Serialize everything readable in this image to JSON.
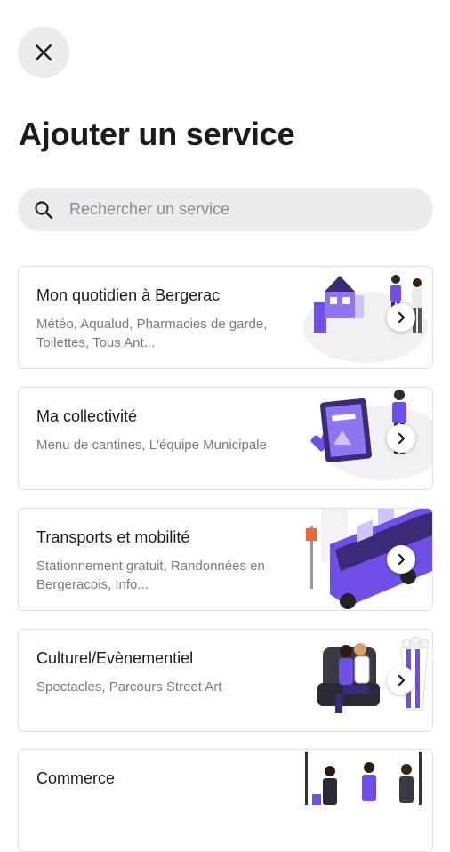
{
  "header": {
    "close_icon": "close-icon",
    "title": "Ajouter un service"
  },
  "search": {
    "placeholder": "Rechercher un service",
    "icon": "search-icon"
  },
  "services": [
    {
      "title": "Mon quotidien à Bergerac",
      "description": "Météo, Aqualud, Pharmacies de garde, Toilettes, Tous Ant..."
    },
    {
      "title": "Ma collectivité",
      "description": "Menu de cantines, L'équipe Municipale"
    },
    {
      "title": "Transports et mobilité",
      "description": "Stationnement gratuit, Randonnées en Bergeracois, Info..."
    },
    {
      "title": "Culturel/Evènementiel",
      "description": "Spectacles, Parcours Street Art"
    },
    {
      "title": "Commerce",
      "description": ""
    }
  ],
  "colors": {
    "accent": "#6f4fe8",
    "accent_dark": "#3b2a7a",
    "search_bg": "#ececee",
    "card_border": "#e3e3e6"
  }
}
